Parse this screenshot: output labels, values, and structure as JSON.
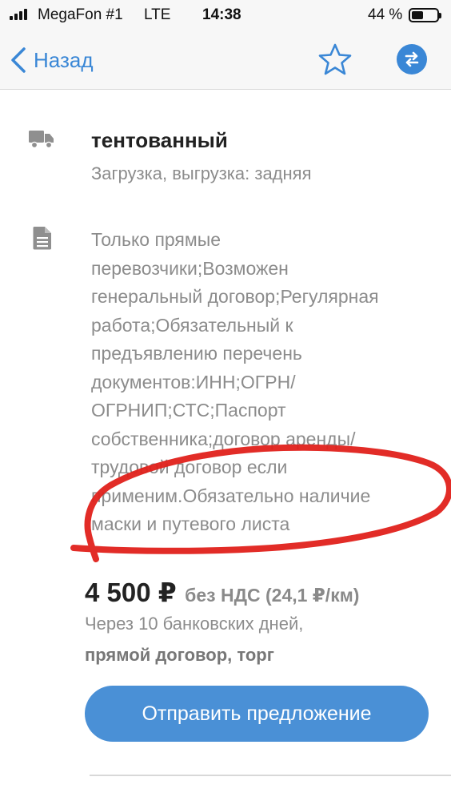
{
  "status_bar": {
    "carrier": "MegaFon #1",
    "network": "LTE",
    "time": "14:38",
    "battery": "44 %",
    "battery_level": 0.44
  },
  "nav": {
    "back_label": "Назад",
    "icons": [
      "chevron-left-icon",
      "star-icon",
      "swap-icon"
    ]
  },
  "cargo": {
    "body_type": "тентованный",
    "loading": "Загрузка, выгрузка: задняя",
    "comment_lines": [
      "Только прямые",
      "перевозчики;Возможен",
      "генеральный договор;Регулярная",
      "работа;Обязательный к",
      "предъявлению перечень",
      "документов:ИНН;ОГРН/",
      "ОГРНИП;СТС;Паспорт",
      "собственника;договор аренды/",
      "трудовой договор если",
      "применим.Обязательно наличие",
      "маски и путевого листа"
    ]
  },
  "price": {
    "amount": "4 500 ₽",
    "details": "без НДС (24,1 ₽/км)",
    "payment_terms": "Через 10 банковских дней,",
    "contract_terms": "прямой договор, торг"
  },
  "actions": {
    "send_offer_label": "Отправить предложение"
  },
  "colors": {
    "accent": "#3a87d6",
    "button": "#4a90d6",
    "annotation": "#e0211b"
  }
}
